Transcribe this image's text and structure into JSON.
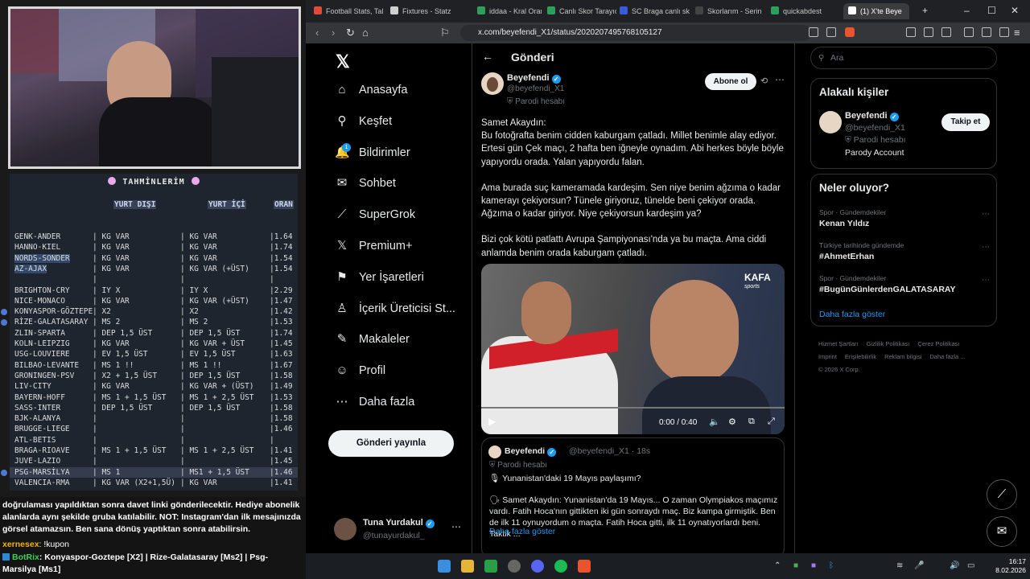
{
  "overlay": {
    "predictions": {
      "title": "TAHMİNLERİM",
      "headers": {
        "yurt_disi": "YURT DIŞI",
        "yurt_ici": "YURT İÇİ",
        "oran": "ORAN"
      },
      "rows": [
        {
          "match": "GENK-ANDER",
          "yd": "KG VAR",
          "yi": "KG VAR",
          "oran": "1.64"
        },
        {
          "match": "HANNO-KIEL",
          "yd": "KG VAR",
          "yi": "KG VAR",
          "oran": "1.74"
        },
        {
          "match": "NORDS-SONDER",
          "yd": "KG VAR",
          "yi": "KG VAR",
          "oran": "1.54"
        },
        {
          "match": "AZ-AJAX",
          "yd": "KG VAR",
          "yi": "KG VAR (+ÜST)",
          "oran": "1.54"
        },
        {
          "match": "",
          "yd": "",
          "yi": "",
          "oran": ""
        },
        {
          "match": "BRIGHTON-CRY",
          "yd": "IY X",
          "yi": "IY X",
          "oran": "2.29"
        },
        {
          "match": "NICE-MONACO",
          "yd": "KG VAR",
          "yi": "KG VAR (+ÜST)",
          "oran": "1.47"
        },
        {
          "match": "KONYASPOR-GÖZTEPE",
          "yd": "X2",
          "yi": "X2",
          "oran": "1.42"
        },
        {
          "match": "RİZE-GALATASARAY",
          "yd": "MS 2",
          "yi": "MS 2",
          "oran": "1.53"
        },
        {
          "match": "ZLIN-SPARTA",
          "yd": "DEP 1,5 ÜST",
          "yi": "DEP 1,5 ÜST",
          "oran": "1.74"
        },
        {
          "match": "KOLN-LEIPZIG",
          "yd": "KG VAR",
          "yi": "KG VAR + ÜST",
          "oran": "1.45"
        },
        {
          "match": "USG-LOUVIERE",
          "yd": "EV 1,5 ÜST",
          "yi": "EV 1,5 ÜST",
          "oran": "1.63"
        },
        {
          "match": "BILBAO-LEVANTE",
          "yd": "MS 1 !!",
          "yi": "MS 1 !!",
          "oran": "1.67"
        },
        {
          "match": "GRONINGEN-PSV",
          "yd": "X2 + 1,5 ÜST",
          "yi": "DEP 1,5 ÜST",
          "oran": "1.58"
        },
        {
          "match": "LIV-CITY",
          "yd": "KG VAR",
          "yi": "KG VAR + (ÜST)",
          "oran": "1.49"
        },
        {
          "match": "BAYERN-HOFF",
          "yd": "MS 1 + 1,5 ÜST",
          "yi": "MS 1 + 2,5 ÜST",
          "oran": "1.53"
        },
        {
          "match": "SASS-INTER",
          "yd": "DEP 1,5 ÜST",
          "yi": "DEP 1,5 ÜST",
          "oran": "1.58"
        },
        {
          "match": "BJK-ALANYA",
          "yd": "",
          "yi": "",
          "oran": "1.58"
        },
        {
          "match": "BRUGGE-LIEGE",
          "yd": "",
          "yi": "",
          "oran": "1.46"
        },
        {
          "match": "ATL-BETIS",
          "yd": "",
          "yi": "",
          "oran": ""
        },
        {
          "match": "BRAGA-RIOAVE",
          "yd": "MS 1 + 1,5 ÜST",
          "yi": "MS 1 + 2,5 ÜST",
          "oran": "1.41"
        },
        {
          "match": "JUVE-LAZIO",
          "yd": "",
          "yi": "",
          "oran": "1.45"
        },
        {
          "match": "PSG-MARSİLYA",
          "yd": "MS 1",
          "yi": "MS1 + 1,5 ÜST",
          "oran": "1.46"
        },
        {
          "match": "VALENCIA-RMA",
          "yd": "KG VAR (X2+1,5Ü)",
          "yi": "KG VAR",
          "oran": "1.41"
        }
      ]
    },
    "chat": {
      "message": "doğrulaması yapıldıktan sonra davet linki gönderilecektir. Hediye abonelik alanlarda aynı şekilde gruba katılabilir. NOT: Instagram'dan ilk mesajınızda görsel atamazsın. Ben sana dönüş yaptıktan sonra atabilirsin.",
      "user": "xernesex",
      "user_cmd": ": !kupon",
      "bot_name": "BotRix",
      "bot_text": ": Konyaspor-Goztepe [X2] | Rize-Galatasaray [Ms2] | Psg-Marsilya [Ms1]"
    }
  },
  "browser": {
    "tabs": [
      {
        "label": "Football Stats, Tal",
        "color": "#e04a3a"
      },
      {
        "label": "Fixtures - Statz",
        "color": "#d0d0d0"
      },
      {
        "label": "iddaa - Kral Oran",
        "color": "#2e9e5b"
      },
      {
        "label": "Canlı Skor Tarayıc",
        "color": "#2e9e5b"
      },
      {
        "label": "SC Braga canlı sk",
        "color": "#3a5bd9"
      },
      {
        "label": "Skorlarım - Serin",
        "color": "#444444"
      },
      {
        "label": "quickabdest",
        "color": "#2e9e5b"
      },
      {
        "label": "(1) X'te Beye",
        "color": "#ffffff"
      }
    ],
    "url": "x.com/beyefendi_X1/status/2020207495768105127"
  },
  "x": {
    "nav": [
      {
        "icon": "home-icon",
        "glyph": "⌂",
        "label": "Anasayfa"
      },
      {
        "icon": "search-icon",
        "glyph": "⚲",
        "label": "Keşfet"
      },
      {
        "icon": "bell-icon",
        "glyph": "🔔",
        "label": "Bildirimler"
      },
      {
        "icon": "mail-icon",
        "glyph": "✉",
        "label": "Sohbet"
      },
      {
        "icon": "grok-icon",
        "glyph": "⟋",
        "label": "SuperGrok"
      },
      {
        "icon": "x-premium-icon",
        "glyph": "𝕏",
        "label": "Premium+"
      },
      {
        "icon": "bookmark-icon",
        "glyph": "⚑",
        "label": "Yer İşaretleri"
      },
      {
        "icon": "creator-icon",
        "glyph": "♙",
        "label": "İçerik Üreticisi St..."
      },
      {
        "icon": "articles-icon",
        "glyph": "✎",
        "label": "Makaleler"
      },
      {
        "icon": "profile-icon",
        "glyph": "☺",
        "label": "Profil"
      },
      {
        "icon": "more-icon",
        "glyph": "⋯",
        "label": "Daha fazla"
      }
    ],
    "notif_count": "1",
    "post_button": "Gönderi yayınla",
    "account": {
      "name": "Tuna Yurdakul",
      "handle": "@tunayurdakul_"
    },
    "post": {
      "header": "Gönderi",
      "author": "Beyefendi",
      "handle": "@beyefendi_X1",
      "parody": "Parodi hesabı",
      "follow": "Abone ol",
      "paragraphs": [
        "Samet Akaydın:\nBu fotoğrafta benim cidden kaburgam çatladı. Millet benimle alay ediyor. Ertesi gün Çek maçı, 2 hafta ben iğneyle oynadım. Abi herkes böyle böyle yapıyordu orada. Yalan yapıyordu falan.",
        "Ama burada suç kameramada kardeşim. Sen niye benim ağzıma o kadar kamerayı çekiyorsun? Tünele giriyoruz, tünelde beni çekiyor orada. Ağzıma o kadar giriyor. Niye çekiyorsun kardeşim ya?",
        "Bizi çok kötü patlattı Avrupa Şampiyonası'nda ya bu maçta. Ama ciddi anlamda benim orada kaburgam çatladı."
      ],
      "video_time": "0:00 / 0:40",
      "video_logo": "KAFA",
      "video_logo_sub": "sports"
    },
    "quote": {
      "author": "Beyefendi",
      "handle": "@beyefendi_X1 · 18s",
      "parody": "Parodi hesabı",
      "line1": "Yunanistan'daki 19 Mayıs paylaşımı?",
      "line2": "Samet Akaydın: Yunanistan'da 19 Mayıs... O zaman Olympiakos maçımız vardı. Fatih Hoca'nın gittikten iki gün sonraydı maç. Biz kampa girmiştik. Ben de ilk 11 oynuyordum o maçta. Fatih Hoca gitti, ilk 11 oynatıyorlardı beni. Taktik ...",
      "more": "Daha fazla göster"
    },
    "right": {
      "search_placeholder": "Ara",
      "related_title": "Alakalı kişiler",
      "related": {
        "name": "Beyefendi",
        "handle": "@beyefendi_X1",
        "parody": "Parodi hesabı",
        "account": "Parody Account",
        "follow": "Takip et"
      },
      "trends_title": "Neler oluyor?",
      "trends": [
        {
          "context": "Spor · Gündemdekiler",
          "name": "Kenan Yıldız"
        },
        {
          "context": "Türkiye tarihinde gündemde",
          "name": "#AhmetErhan"
        },
        {
          "context": "Spor · Gündemdekiler",
          "name": "#BugünGünlerdenGALATASARAY"
        }
      ],
      "trends_more": "Daha fazla göster",
      "footer": [
        "Hizmet Şartları",
        "Gizlilik Politikası",
        "Çerez Politikası",
        "Imprint",
        "Erişilebilirlik",
        "Reklam bilgisi",
        "Daha fazla ...",
        "© 2026 X Corp."
      ]
    }
  },
  "taskbar": {
    "time": "16:17",
    "date": "8.02.2026"
  }
}
